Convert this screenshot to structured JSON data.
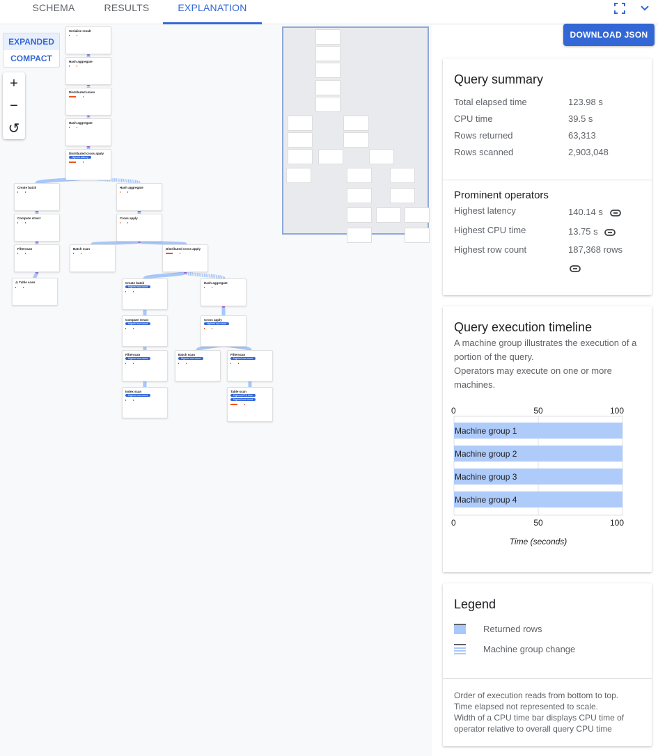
{
  "tabs": [
    {
      "label": "SCHEMA",
      "active": false
    },
    {
      "label": "RESULTS",
      "active": false
    },
    {
      "label": "EXPLANATION",
      "active": true
    }
  ],
  "header_icons": [
    "fullscreen-icon",
    "chevron-down-icon"
  ],
  "view_mode": {
    "options": [
      "EXPANDED",
      "COMPACT"
    ],
    "selected": "EXPANDED"
  },
  "zoom_controls": {
    "zoom_in": "+",
    "zoom_out": "−",
    "reset": "↺"
  },
  "download_button": "DOWNLOAD JSON",
  "plan_nodes": [
    {
      "id": "n1",
      "title": "Serialize result",
      "badges": [],
      "cpu_bar": false
    },
    {
      "id": "n2",
      "title": "Hash aggregate",
      "badges": [],
      "cpu_bar": false
    },
    {
      "id": "n3",
      "title": "Distributed union",
      "badges": [],
      "cpu_bar": true
    },
    {
      "id": "n4",
      "title": "Hash aggregate",
      "badges": [],
      "cpu_bar": false
    },
    {
      "id": "n5",
      "title": "Distributed cross apply",
      "badges": [
        "Highest latency"
      ],
      "cpu_bar": true
    },
    {
      "id": "n6",
      "title": "Create batch",
      "badges": [],
      "cpu_bar": false
    },
    {
      "id": "n7",
      "title": "Hash aggregate",
      "badges": [],
      "cpu_bar": false
    },
    {
      "id": "n8",
      "title": "Compute struct",
      "badges": [],
      "cpu_bar": false
    },
    {
      "id": "n9",
      "title": "Cross apply",
      "badges": [],
      "cpu_bar": false
    },
    {
      "id": "n10",
      "title": "Filterscan",
      "badges": [],
      "cpu_bar": false
    },
    {
      "id": "n11",
      "title": "Batch scan",
      "badges": [],
      "cpu_bar": false
    },
    {
      "id": "n12",
      "title": "Distributed cross apply",
      "badges": [],
      "cpu_bar": true
    },
    {
      "id": "n13",
      "title": "Table scan",
      "badges": [],
      "cpu_bar": false,
      "warning": true
    },
    {
      "id": "n14",
      "title": "Create batch",
      "badges": [
        "Highest row count"
      ],
      "cpu_bar": false
    },
    {
      "id": "n15",
      "title": "Hash aggregate",
      "badges": [],
      "cpu_bar": false
    },
    {
      "id": "n16",
      "title": "Compute struct",
      "badges": [
        "Highest row count"
      ],
      "cpu_bar": false
    },
    {
      "id": "n17",
      "title": "Cross apply",
      "badges": [
        "Highest row count"
      ],
      "cpu_bar": false
    },
    {
      "id": "n18",
      "title": "Filterscan",
      "badges": [
        "Highest row count"
      ],
      "cpu_bar": false
    },
    {
      "id": "n19",
      "title": "Batch scan",
      "badges": [
        "Highest row count"
      ],
      "cpu_bar": false
    },
    {
      "id": "n20",
      "title": "Filterscan",
      "badges": [
        "Highest row count"
      ],
      "cpu_bar": false
    },
    {
      "id": "n21",
      "title": "Index scan",
      "badges": [
        "Highest row count"
      ],
      "cpu_bar": false
    },
    {
      "id": "n22",
      "title": "Table scan",
      "badges": [
        "Highest CPU time",
        "Highest row count"
      ],
      "cpu_bar": true
    }
  ],
  "query_summary": {
    "title": "Query summary",
    "rows": [
      {
        "label": "Total elapsed time",
        "value": "123.98 s"
      },
      {
        "label": "CPU time",
        "value": "39.5 s"
      },
      {
        "label": "Rows returned",
        "value": "63,313"
      },
      {
        "label": "Rows scanned",
        "value": "2,903,048"
      }
    ]
  },
  "prominent_operators": {
    "title": "Prominent operators",
    "rows": [
      {
        "label": "Highest latency",
        "value": "140.14 s"
      },
      {
        "label": "Highest CPU time",
        "value": "13.75 s"
      },
      {
        "label": "Highest row count",
        "value": "187,368 rows"
      }
    ]
  },
  "timeline": {
    "title": "Query execution timeline",
    "desc1": "A machine group illustrates the execution of a portion of the query.",
    "desc2": "Operators may execute on one or more machines."
  },
  "chart_data": {
    "type": "bar",
    "orientation": "horizontal",
    "categories": [
      "Machine group 1",
      "Machine group 2",
      "Machine group 3",
      "Machine group 4"
    ],
    "series": [
      {
        "name": "Machine group execution",
        "start": [
          0,
          0,
          0,
          0
        ],
        "end": [
          100,
          100,
          100,
          100
        ]
      }
    ],
    "xlabel": "Time (seconds)",
    "xticks": [
      "0",
      "50",
      "100"
    ],
    "xlim": [
      0,
      100
    ],
    "bar_color": "#aecbfa",
    "grid": true
  },
  "legend": {
    "title": "Legend",
    "items": [
      {
        "label": "Returned rows",
        "icon": "returned-rows-swatch"
      },
      {
        "label": "Machine group change",
        "icon": "machine-group-change-swatch"
      }
    ],
    "notes": [
      "Order of execution reads from bottom to top.",
      "Time elapsed not represented to scale.",
      "Width of a CPU time bar displays CPU time of operator relative to overall query CPU time"
    ]
  },
  "colors": {
    "accent": "#3367d6",
    "bar": "#aecbfa",
    "cpu_bar": "#f4511e",
    "edge": "#a8c7fa"
  }
}
